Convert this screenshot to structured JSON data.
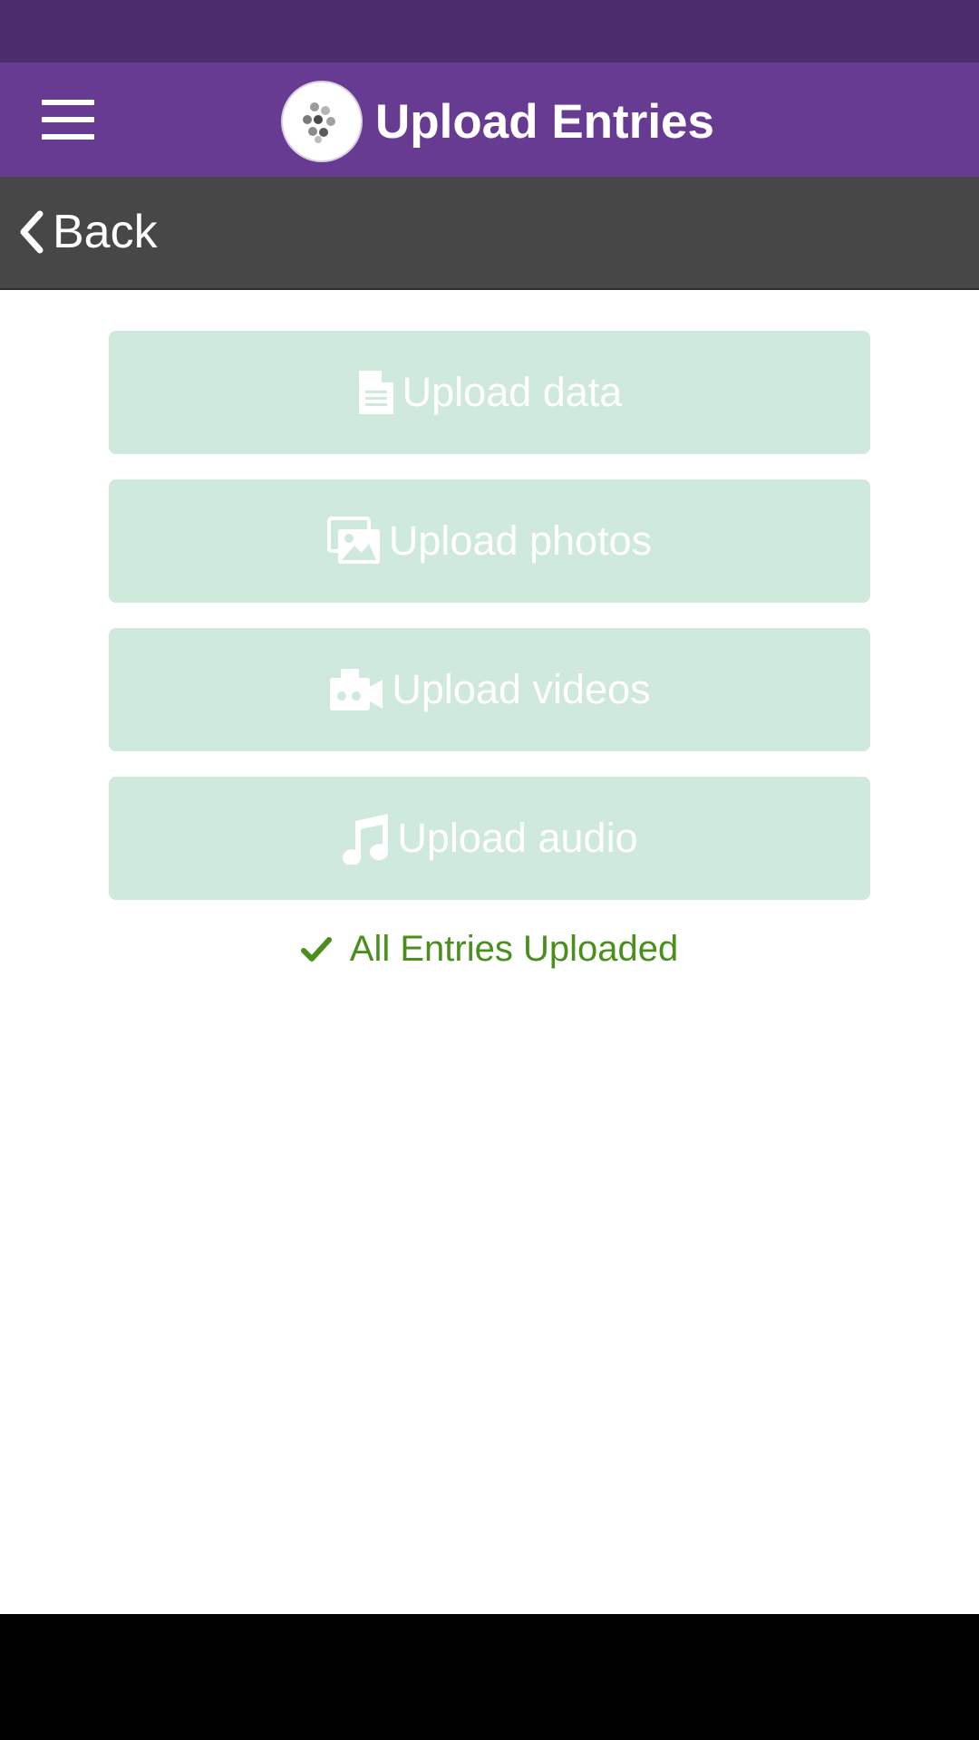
{
  "app": {
    "title": "Upload Entries",
    "logo_icon": "dots-logo-icon",
    "menu_icon": "hamburger-menu-icon"
  },
  "nav": {
    "back_label": "Back",
    "back_icon": "chevron-left-icon"
  },
  "buttons": [
    {
      "label": "Upload data",
      "icon": "file-icon"
    },
    {
      "label": "Upload photos",
      "icon": "photos-icon"
    },
    {
      "label": "Upload videos",
      "icon": "video-camera-icon"
    },
    {
      "label": "Upload audio",
      "icon": "music-note-icon"
    }
  ],
  "status": {
    "text": "All Entries Uploaded",
    "icon": "check-icon"
  },
  "colors": {
    "status_bar": "#4b2c6c",
    "app_bar": "#673b91",
    "nav_bar": "#474747",
    "button_bg": "#cfe9dc",
    "success": "#4a8e1c"
  }
}
